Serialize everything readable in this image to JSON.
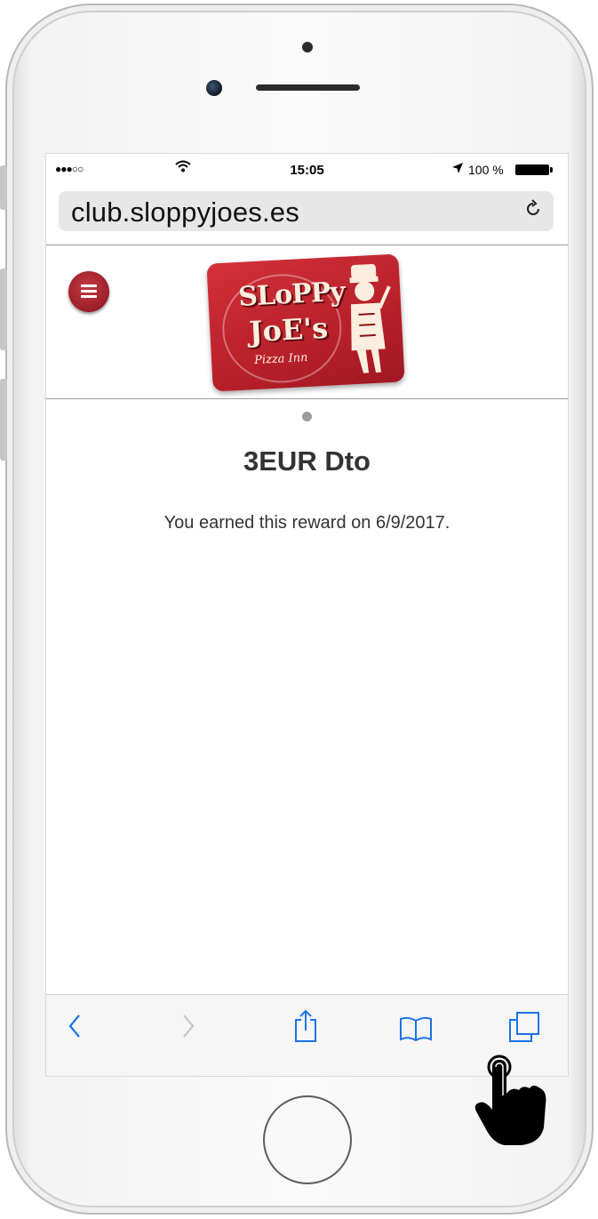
{
  "status_bar": {
    "signal": "●●●○○",
    "wifi_icon": "wifi-icon",
    "time": "15:05",
    "location_icon": "location-arrow-icon",
    "battery_percent": "100 %",
    "battery_icon": "battery-icon"
  },
  "browser": {
    "url": "club.sloppyjoes.es",
    "reload_icon": "reload-icon"
  },
  "header": {
    "menu_icon": "hamburger-menu-icon",
    "logo": {
      "line1": "SLoPPy",
      "line2": "JoE's",
      "line3": "Pizza Inn"
    }
  },
  "reward": {
    "title": "3EUR Dto",
    "description": "You earned this reward on 6/9/2017."
  },
  "toolbar": {
    "icons": [
      "back-icon",
      "forward-icon",
      "share-icon",
      "bookmarks-icon",
      "tabs-icon"
    ]
  },
  "colors": {
    "brand_red": "#b8202a",
    "ios_blue": "#1a73e8",
    "text": "#333333"
  }
}
